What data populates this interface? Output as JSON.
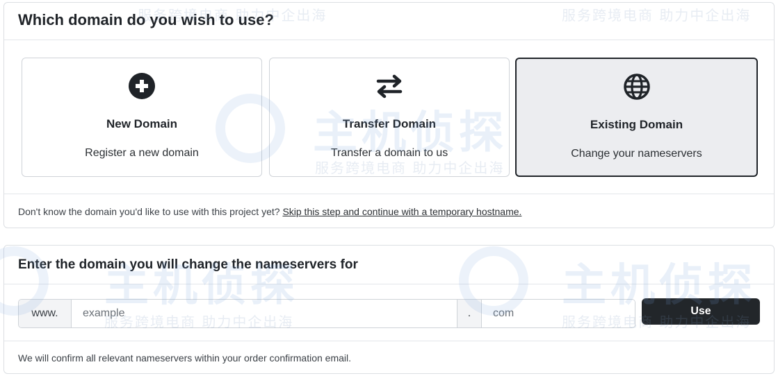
{
  "domain_choice": {
    "heading": "Which domain do you wish to use?",
    "options": [
      {
        "icon": "plus-circle-icon",
        "title": "New Domain",
        "description": "Register a new domain",
        "selected": false
      },
      {
        "icon": "transfer-arrows-icon",
        "title": "Transfer Domain",
        "description": "Transfer a domain to us",
        "selected": false
      },
      {
        "icon": "globe-icon",
        "title": "Existing Domain",
        "description": "Change your nameservers",
        "selected": true
      }
    ],
    "footnote_text": "Don't know the domain you'd like to use with this project yet?",
    "footnote_link": "Skip this step and continue with a temporary hostname."
  },
  "nameservers": {
    "heading": "Enter the domain you will change the nameservers for",
    "prefix": "www.",
    "name_placeholder": "example",
    "name_value": "",
    "separator": ".",
    "tld_placeholder": "com",
    "tld_value": "",
    "use_label": "Use",
    "confirm_note": "We will confirm all relevant nameservers within your order confirmation email."
  },
  "watermark": {
    "text": "服务跨境电商 助力中企出海",
    "brand": "主机侦探"
  },
  "colors": {
    "accent_dark": "#22262a",
    "selected_bg": "#ecedf0",
    "border": "#cfd3d8"
  }
}
